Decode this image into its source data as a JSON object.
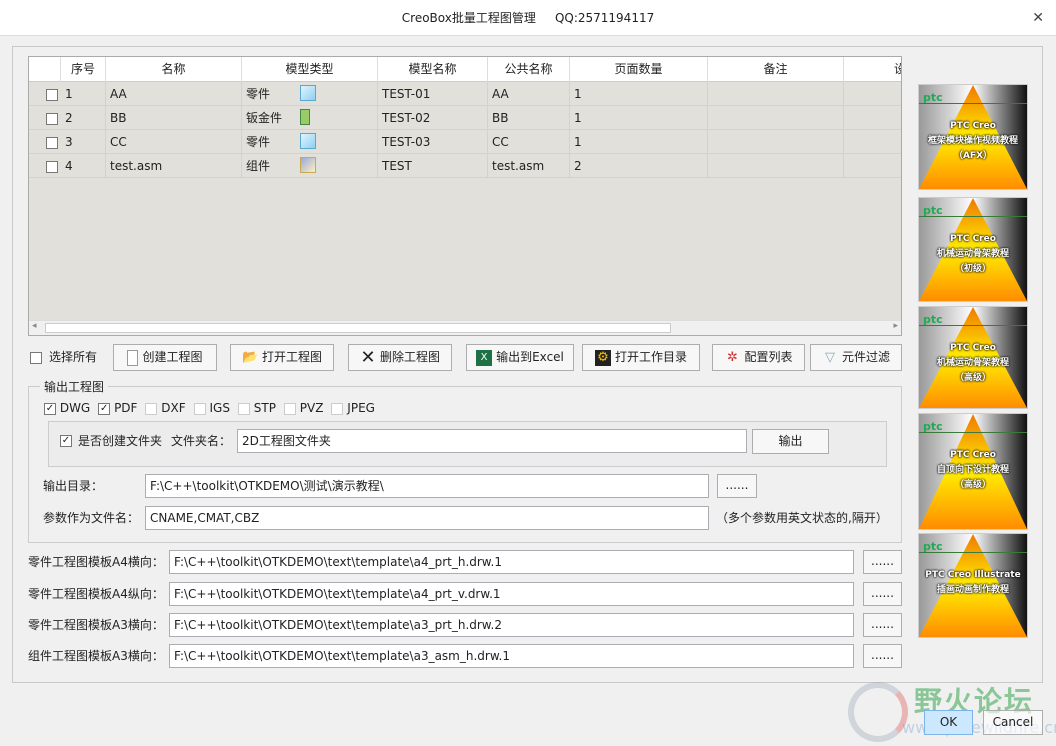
{
  "window": {
    "title": "CreoBox批量工程图管理",
    "qq": "QQ:2571194117",
    "close": "✕"
  },
  "table": {
    "headers": [
      "",
      "序号",
      "名称",
      "模型类型",
      "模型名称",
      "公共名称",
      "页面数量",
      "备注",
      "设"
    ],
    "rows": [
      {
        "checked": false,
        "index": "1",
        "name": "AA",
        "type": "零件",
        "icon": "part-icon",
        "model": "TEST-01",
        "common": "AA",
        "pages": "1",
        "note": ""
      },
      {
        "checked": false,
        "index": "2",
        "name": "BB",
        "type": "钣金件",
        "icon": "sheetmetal-icon",
        "model": "TEST-02",
        "common": "BB",
        "pages": "1",
        "note": ""
      },
      {
        "checked": false,
        "index": "3",
        "name": "CC",
        "type": "零件",
        "icon": "part-icon",
        "model": "TEST-03",
        "common": "CC",
        "pages": "1",
        "note": ""
      },
      {
        "checked": false,
        "index": "4",
        "name": "test.asm",
        "type": "组件",
        "icon": "assembly-icon",
        "model": "TEST",
        "common": "test.asm",
        "pages": "2",
        "note": ""
      }
    ]
  },
  "toolbar": {
    "select_all": "选择所有",
    "create": "创建工程图",
    "open": "打开工程图",
    "delete": "删除工程图",
    "excel": "输出到Excel",
    "open_dir": "打开工作目录",
    "config": "配置列表",
    "filter": "元件过滤"
  },
  "output": {
    "group_title": "输出工程图",
    "formats": [
      {
        "label": "DWG",
        "checked": true
      },
      {
        "label": "PDF",
        "checked": true
      },
      {
        "label": "DXF",
        "checked": false
      },
      {
        "label": "IGS",
        "checked": false
      },
      {
        "label": "STP",
        "checked": false
      },
      {
        "label": "PVZ",
        "checked": false
      },
      {
        "label": "JPEG",
        "checked": false
      }
    ],
    "create_folder_label": "是否创建文件夹",
    "create_folder_checked": true,
    "folder_name_label": "文件夹名：",
    "folder_name": "2D工程图文件夹",
    "export_button": "输出",
    "dir_label": "输出目录：",
    "dir_value": "F:\\C++\\toolkit\\OTKDEMO\\测试\\演示教程\\",
    "browse": "......",
    "param_label": "参数作为文件名：",
    "param_value": "CNAME,CMAT,CBZ",
    "param_hint": "（多个参数用英文状态的,隔开）"
  },
  "templates": [
    {
      "label": "零件工程图模板A4横向：",
      "value": "F:\\C++\\toolkit\\OTKDEMO\\text\\template\\a4_prt_h.drw.1",
      "browse": "......"
    },
    {
      "label": "零件工程图模板A4纵向：",
      "value": "F:\\C++\\toolkit\\OTKDEMO\\text\\template\\a4_prt_v.drw.1",
      "browse": "......"
    },
    {
      "label": "零件工程图模板A3横向：",
      "value": "F:\\C++\\toolkit\\OTKDEMO\\text\\template\\a3_prt_h.drw.2",
      "browse": "......"
    },
    {
      "label": "组件工程图模板A3横向：",
      "value": "F:\\C++\\toolkit\\OTKDEMO\\text\\template\\a3_asm_h.drw.1",
      "browse": "......"
    }
  ],
  "ads": [
    {
      "logo": "ptc",
      "l1": "PTC Creo",
      "l2": "框架模块操作视频教程",
      "l3": "（AFX）"
    },
    {
      "logo": "ptc",
      "l1": "PTC Creo",
      "l2": "机械运动骨架教程",
      "l3": "（初级）"
    },
    {
      "logo": "ptc",
      "l1": "PTC Creo",
      "l2": "机械运动骨架教程",
      "l3": "（高级）"
    },
    {
      "logo": "ptc",
      "l1": "PTC Creo",
      "l2": "自顶向下设计教程",
      "l3": "（高级）"
    },
    {
      "logo": "ptc",
      "l1": "PTC Creo Illustrate",
      "l2": "插画动画制作教程",
      "l3": ""
    }
  ],
  "footer": {
    "ok": "OK",
    "cancel": "Cancel",
    "watermark": "野火论坛",
    "watermark_url": "www.proewildfire.cn"
  },
  "colors": {
    "ok_bg": "#cce8ff",
    "grid_bg": "#e1e0da"
  }
}
